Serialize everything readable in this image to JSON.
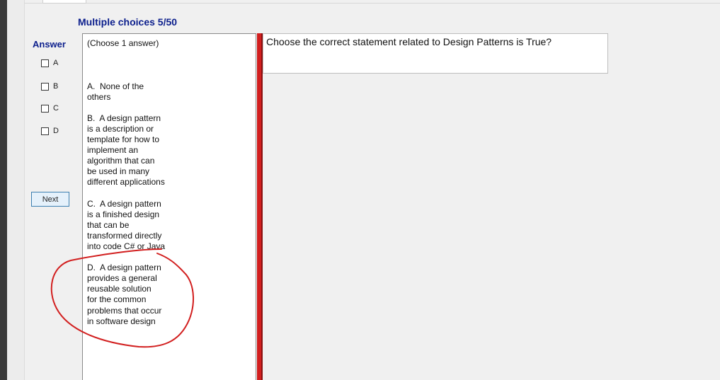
{
  "quiz": {
    "title": "Multiple choices 5/50",
    "question": "Choose the correct statement related to Design Patterns is True?"
  },
  "answer_panel": {
    "label": "Answer",
    "choices": [
      "A",
      "B",
      "C",
      "D"
    ],
    "next_label": "Next"
  },
  "options_panel": {
    "instruction": "(Choose 1 answer)",
    "option_a": [
      "A.  None of the",
      "others"
    ],
    "option_b": [
      "B.  A design pattern",
      "is a description or",
      "template for how to",
      "implement an",
      "algorithm that can",
      "be used in many",
      "different applications"
    ],
    "option_c": [
      "C.  A design pattern",
      "is a finished design",
      "that can be",
      "transformed directly",
      "into code C# or Java"
    ],
    "option_d": [
      "D.  A design pattern",
      "provides a general",
      "reusable solution",
      "for the common",
      "problems that occur",
      "in software design"
    ]
  },
  "colors": {
    "title": "#0b1e8c",
    "divider": "#d21f1f",
    "annotation": "#d21f1f"
  }
}
